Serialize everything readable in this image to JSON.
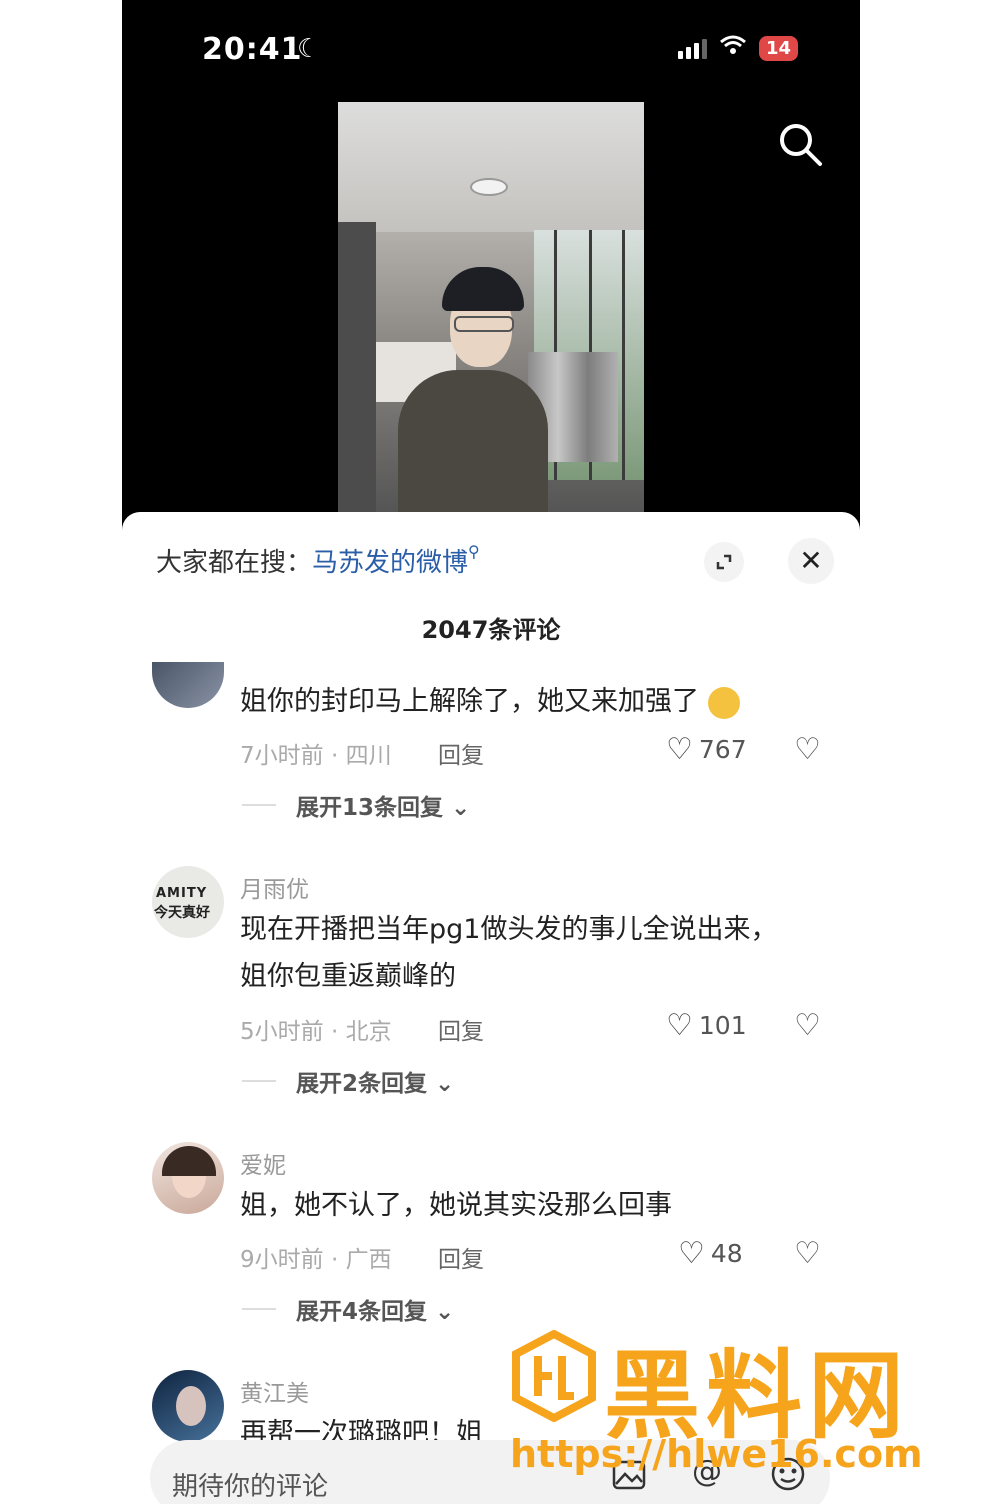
{
  "status_bar": {
    "time": "20:41",
    "battery": "14"
  },
  "sheet": {
    "hot_search_prefix": "大家都在搜：",
    "hot_search_term": "马苏发的微博",
    "comment_count": "2047条评论"
  },
  "comments": [
    {
      "username": "",
      "text_lines": [
        "姐你的封印马上解除了，她又来加强了"
      ],
      "meta": "7小时前 · 四川",
      "reply": "回复",
      "likes": "767",
      "expand": "展开13条回复"
    },
    {
      "username": "月雨优",
      "text_lines": [
        "现在开播把当年pg1做头发的事儿全说出来，",
        "姐你包重返巅峰的"
      ],
      "meta": "5小时前 · 北京",
      "reply": "回复",
      "likes": "101",
      "expand": "展开2条回复"
    },
    {
      "username": "爱妮",
      "text_lines": [
        "姐，她不认了，她说其实没那么回事"
      ],
      "meta": "9小时前 · 广西",
      "reply": "回复",
      "likes": "48",
      "expand": "展开4条回复"
    },
    {
      "username": "黄江美",
      "text_lines": [
        "再帮一次璐璐吧！姐"
      ]
    }
  ],
  "input": {
    "placeholder": "期待你的评论"
  },
  "watermark": {
    "title": "黑料网",
    "url": "https://hlwe16.com"
  },
  "icons": {
    "search": "search-icon",
    "expand": "expand-icon",
    "close": "close-icon",
    "like": "heart-icon",
    "dislike": "broken-heart-icon",
    "image": "image-icon",
    "at": "at-icon",
    "emoji": "emoji-icon"
  }
}
